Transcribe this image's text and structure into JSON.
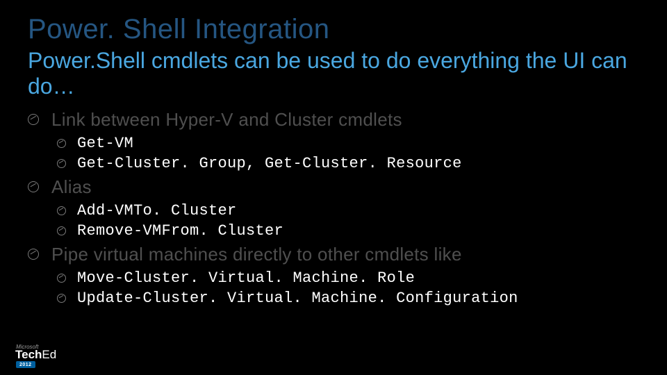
{
  "title": "Power. Shell Integration",
  "subtitle": "Power.Shell cmdlets can be used to do everything the UI can do…",
  "sections": [
    {
      "heading": "Link between Hyper-V and Cluster cmdlets",
      "items": [
        "Get-VM",
        "Get-Cluster. Group, Get-Cluster. Resource"
      ]
    },
    {
      "heading": "Alias",
      "items": [
        "Add-VMTo. Cluster",
        "Remove-VMFrom. Cluster"
      ]
    },
    {
      "heading": "Pipe virtual machines directly to other cmdlets like",
      "items": [
        "Move-Cluster. Virtual. Machine. Role",
        "Update-Cluster. Virtual. Machine. Configuration"
      ]
    }
  ],
  "footer": {
    "vendor": "Microsoft",
    "brand_bold": "Tech",
    "brand_light": "Ed",
    "year": "2012"
  }
}
